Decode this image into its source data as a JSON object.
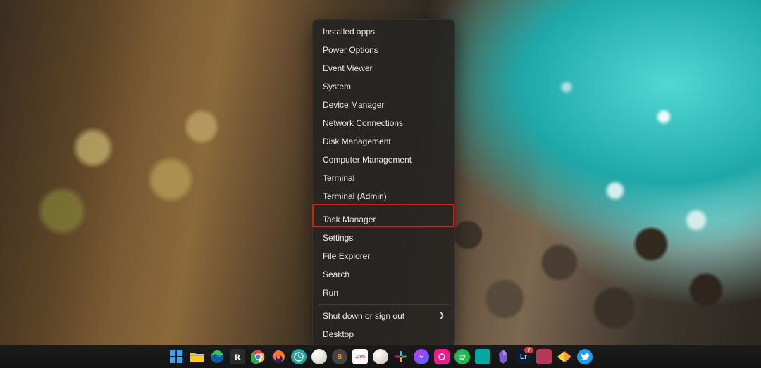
{
  "menu": {
    "groups": [
      [
        {
          "id": "installed-apps",
          "label": "Installed apps"
        },
        {
          "id": "power-options",
          "label": "Power Options"
        },
        {
          "id": "event-viewer",
          "label": "Event Viewer"
        },
        {
          "id": "system",
          "label": "System"
        },
        {
          "id": "device-manager",
          "label": "Device Manager"
        },
        {
          "id": "network-connections",
          "label": "Network Connections"
        },
        {
          "id": "disk-management",
          "label": "Disk Management"
        },
        {
          "id": "computer-management",
          "label": "Computer Management"
        },
        {
          "id": "terminal",
          "label": "Terminal"
        },
        {
          "id": "terminal-admin",
          "label": "Terminal (Admin)"
        }
      ],
      [
        {
          "id": "task-manager",
          "label": "Task Manager",
          "highlighted": true
        },
        {
          "id": "settings",
          "label": "Settings"
        },
        {
          "id": "file-explorer",
          "label": "File Explorer"
        },
        {
          "id": "search",
          "label": "Search"
        },
        {
          "id": "run",
          "label": "Run"
        }
      ],
      [
        {
          "id": "shut-down",
          "label": "Shut down or sign out",
          "submenu": true
        },
        {
          "id": "desktop",
          "label": "Desktop"
        }
      ]
    ]
  },
  "taskbar": {
    "items": [
      {
        "id": "start",
        "name": "start-icon"
      },
      {
        "id": "explorer",
        "name": "file-explorer-icon"
      },
      {
        "id": "edge",
        "name": "edge-icon"
      },
      {
        "id": "app-r",
        "name": "app-r-icon",
        "letter": "R"
      },
      {
        "id": "chrome",
        "name": "chrome-icon"
      },
      {
        "id": "firefox",
        "name": "firefox-icon"
      },
      {
        "id": "app-clock",
        "name": "clock-app-icon"
      },
      {
        "id": "app-round1",
        "name": "round-app-icon"
      },
      {
        "id": "brave",
        "name": "brave-icon",
        "letter": "B"
      },
      {
        "id": "app-calendar",
        "name": "calendar-icon",
        "letter": "JAN"
      },
      {
        "id": "app-round2",
        "name": "round-app-2-icon"
      },
      {
        "id": "slack",
        "name": "slack-icon"
      },
      {
        "id": "messenger",
        "name": "messenger-icon"
      },
      {
        "id": "app-pink",
        "name": "pink-app-icon"
      },
      {
        "id": "spotify",
        "name": "spotify-icon"
      },
      {
        "id": "app-teal",
        "name": "teal-app-icon"
      },
      {
        "id": "obsidian",
        "name": "obsidian-icon"
      },
      {
        "id": "lightroom",
        "name": "lightroom-icon",
        "letter": "Lr",
        "badge": "7"
      },
      {
        "id": "app-box",
        "name": "box-app-icon"
      },
      {
        "id": "app-orange",
        "name": "orange-app-icon"
      },
      {
        "id": "twitter",
        "name": "twitter-icon"
      }
    ]
  }
}
